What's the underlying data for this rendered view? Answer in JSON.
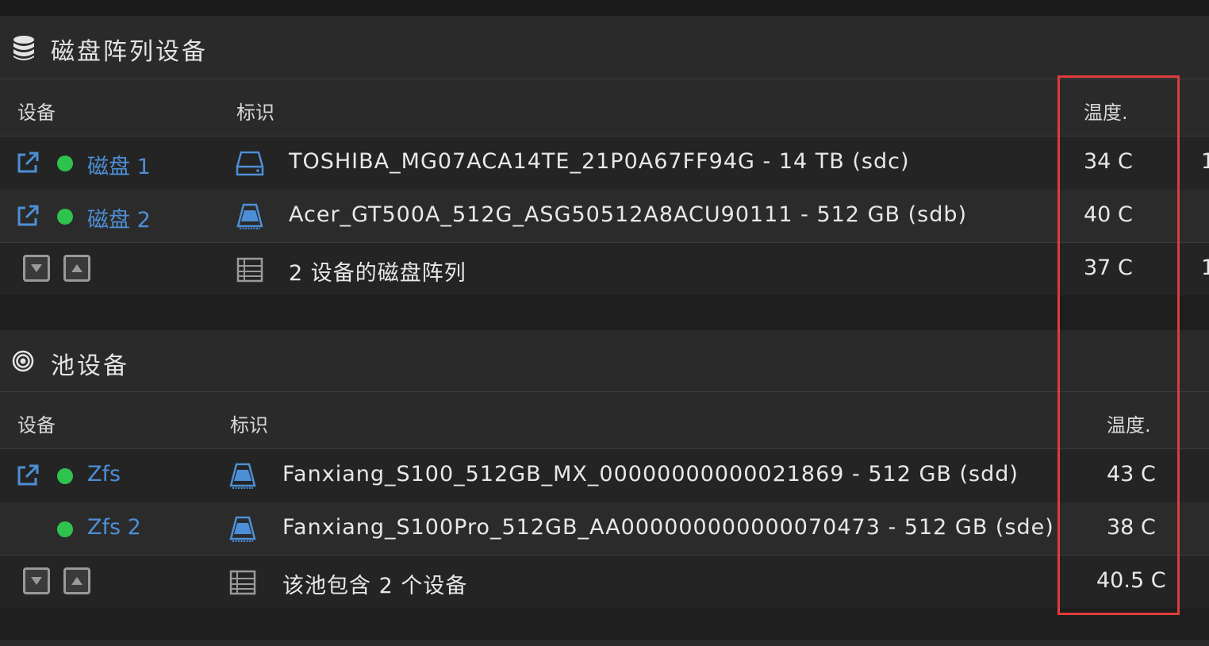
{
  "array_section": {
    "title": "磁盘阵列设备",
    "icon": "database-icon",
    "header": {
      "device": "设备",
      "identification": "标识",
      "temp": "温度."
    },
    "rows": [
      {
        "name": "磁盘 1",
        "ident": "TOSHIBA_MG07ACA14TE_21P0A67FF94G - 14 TB (sdc)",
        "temp": "34 C",
        "extra": "1"
      },
      {
        "name": "磁盘 2",
        "ident": "Acer_GT500A_512G_ASG50512A8ACU90111 - 512 GB (sdb)",
        "temp": "40 C",
        "extra": ""
      }
    ],
    "summary": {
      "ident": "2 设备的磁盘阵列",
      "temp": "37 C",
      "extra": "1"
    }
  },
  "pool_section": {
    "title": "池设备",
    "icon": "target-icon",
    "header": {
      "device": "设备",
      "identification": "标识",
      "temp": "温度."
    },
    "rows": [
      {
        "name": "Zfs",
        "ident": "Fanxiang_S100_512GB_MX_00000000000021869 - 512 GB (sdd)",
        "temp": "43 C"
      },
      {
        "name": "Zfs 2",
        "ident": "Fanxiang_S100Pro_512GB_AA000000000000070473 - 512 GB (sde)",
        "temp": "38 C"
      }
    ],
    "summary": {
      "ident": "该池包含 2 个设备",
      "temp": "40.5 C"
    }
  },
  "colors": {
    "accent": "#4d8fd6",
    "status_ok": "#2fc24e",
    "highlight": "#e03b3b"
  }
}
